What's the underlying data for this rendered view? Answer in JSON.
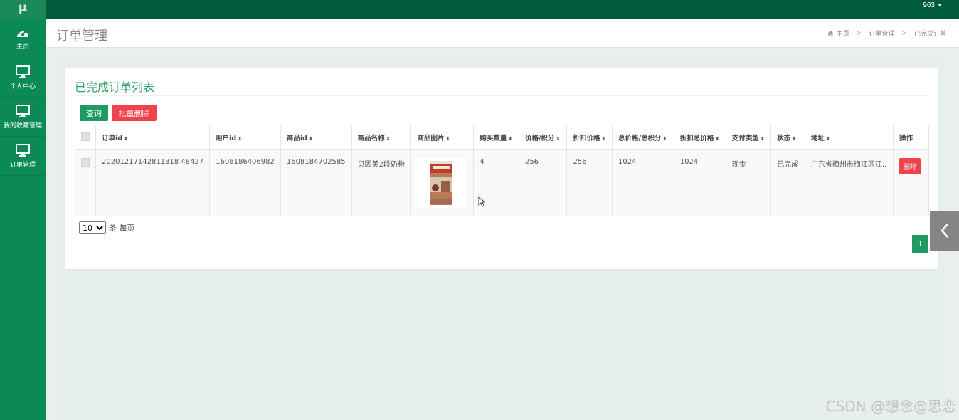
{
  "app": {
    "logo": "μ",
    "user": "963"
  },
  "sidebar": {
    "items": [
      {
        "label": "主页",
        "icon": "dashboard-icon"
      },
      {
        "label": "个人中心",
        "icon": "monitor-icon"
      },
      {
        "label": "我的收藏管理",
        "icon": "monitor-icon"
      },
      {
        "label": "订单管理",
        "icon": "monitor-icon"
      }
    ]
  },
  "header": {
    "title": "订单管理",
    "breadcrumb": [
      "主页",
      "订单管理",
      "已完成订单"
    ]
  },
  "panel": {
    "title": "已完成订单列表",
    "query_label": "查询",
    "bulk_delete_label": "批量删除"
  },
  "table": {
    "columns": [
      "订单id",
      "用户id",
      "商品id",
      "商品名称",
      "商品图片",
      "购买数量",
      "价格/积分",
      "折扣价格",
      "总价格/总积分",
      "折扣总价格",
      "支付类型",
      "状态",
      "地址",
      "操作"
    ],
    "rows": [
      {
        "order_id": "20201217142811318 48427",
        "user_id": "1608186406982",
        "product_id": "1608184702585",
        "product_name": "贝因美2段奶粉",
        "quantity": "4",
        "price": "256",
        "discount_price": "256",
        "total": "1024",
        "discount_total": "1024",
        "pay_type": "现金",
        "status": "已完成",
        "address": "广东省梅州市梅江区江..",
        "action": "删除"
      }
    ]
  },
  "pager": {
    "page_size": "10",
    "per_page_label": "条 每页",
    "current_page": "1"
  },
  "watermark": "CSDN @想念@思恋",
  "colors": {
    "brand": "#0b8a56",
    "topbar": "#005a3c",
    "danger": "#f0414d"
  }
}
